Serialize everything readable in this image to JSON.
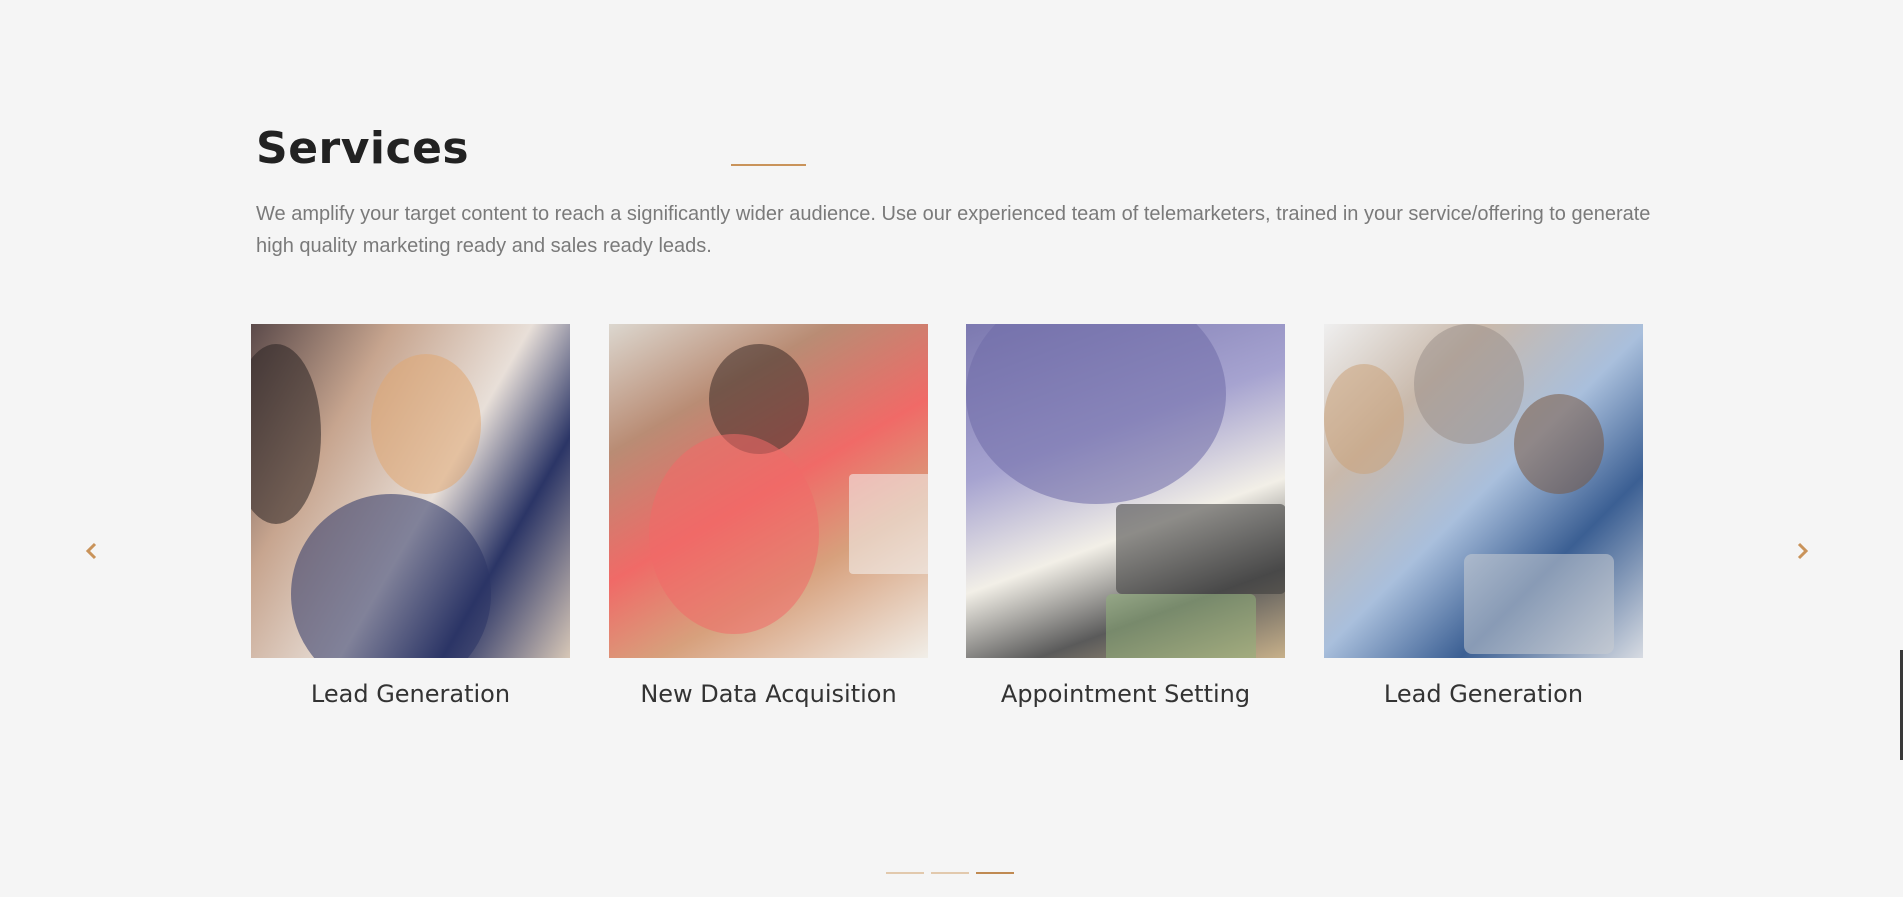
{
  "section": {
    "title": "Services",
    "description": "We amplify your target content to reach a significantly wider audience. Use our experienced team of telemarketers, trained in your service/offering to generate high quality marketing ready and sales ready leads."
  },
  "carousel": {
    "cards": [
      {
        "label": "Lead Generation"
      },
      {
        "label": "New Data Acquisition"
      },
      {
        "label": "Appointment Setting"
      },
      {
        "label": "Lead Generation"
      }
    ],
    "prev_icon": "chevron-left-icon",
    "next_icon": "chevron-right-icon",
    "pagination": {
      "count": 3,
      "active": 3
    }
  },
  "colors": {
    "accent": "#c9935a",
    "background": "#f5f5f5",
    "heading": "#222222",
    "body_text": "#7a7a7a"
  }
}
